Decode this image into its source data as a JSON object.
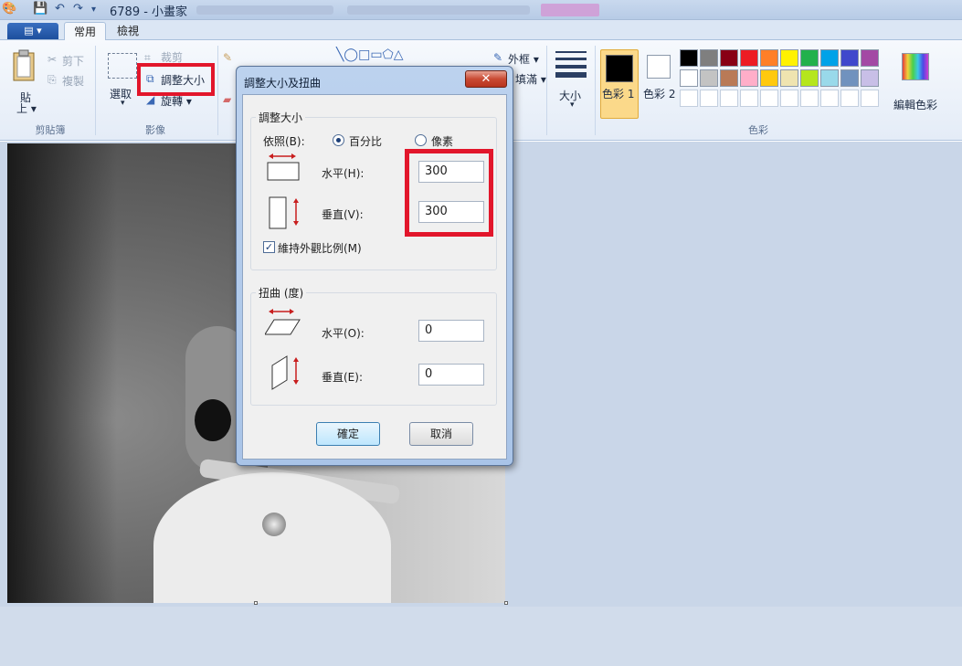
{
  "window": {
    "title": "6789 - 小畫家"
  },
  "ribbon": {
    "app_menu": "▤ ▾",
    "tabs": [
      "常用",
      "檢視"
    ],
    "clipboard": {
      "paste": "貼",
      "paste2": "上 ▾",
      "cut": "剪下",
      "copy": "複製",
      "group": "剪貼簿"
    },
    "image": {
      "select": "選取",
      "crop": "裁剪",
      "resize": "調整大小",
      "rotate": "旋轉 ▾",
      "group": "影像"
    },
    "shapes": {
      "outline": "外框 ▾",
      "fill": "填滿 ▾"
    },
    "size": "大小",
    "colors": {
      "color1": "色彩 1",
      "color2": "色彩 2",
      "edit": "編輯色彩",
      "group": "色彩",
      "palette_row1": [
        "#000000",
        "#7f7f7f",
        "#880015",
        "#ed1c24",
        "#ff7f27",
        "#fff200",
        "#22b14c",
        "#00a2e8",
        "#3f48cc",
        "#a349a4"
      ],
      "palette_row2": [
        "#ffffff",
        "#c3c3c3",
        "#b97a57",
        "#ffaec9",
        "#ffc90e",
        "#efe4b0",
        "#b5e61d",
        "#99d9ea",
        "#7092be",
        "#c8bfe7"
      ]
    }
  },
  "dialog": {
    "title": "調整大小及扭曲",
    "close": "✕",
    "resize_legend": "調整大小",
    "by_label": "依照(B):",
    "percent_label": "百分比",
    "pixels_label": "像素",
    "horizontal_label": "水平(H):",
    "horizontal_value": "300",
    "vertical_label": "垂直(V):",
    "vertical_value": "300",
    "maintain_ratio": "維持外觀比例(M)",
    "skew_legend": "扭曲 (度)",
    "skew_h_label": "水平(O):",
    "skew_h_value": "0",
    "skew_v_label": "垂直(E):",
    "skew_v_value": "0",
    "ok": "確定",
    "cancel": "取消"
  }
}
